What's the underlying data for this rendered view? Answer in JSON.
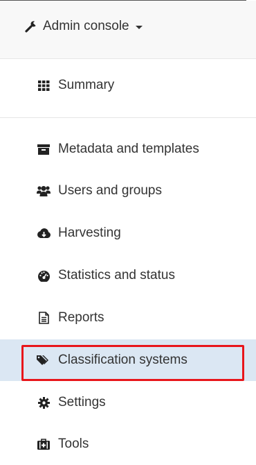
{
  "header": {
    "title": "Admin console",
    "icon": "wrench-icon"
  },
  "summary": {
    "label": "Summary",
    "icon": "th-icon"
  },
  "items": [
    {
      "label": "Metadata and templates",
      "icon": "archive-icon"
    },
    {
      "label": "Users and groups",
      "icon": "users-icon"
    },
    {
      "label": "Harvesting",
      "icon": "cloud-download-icon"
    },
    {
      "label": "Statistics and status",
      "icon": "dashboard-icon"
    },
    {
      "label": "Reports",
      "icon": "file-text-icon"
    },
    {
      "label": "Classification systems",
      "icon": "tags-icon",
      "active": true
    },
    {
      "label": "Settings",
      "icon": "cog-icon"
    },
    {
      "label": "Tools",
      "icon": "medkit-icon"
    }
  ],
  "colors": {
    "active_bg": "#dbe7f3",
    "highlight": "#e8161b"
  }
}
